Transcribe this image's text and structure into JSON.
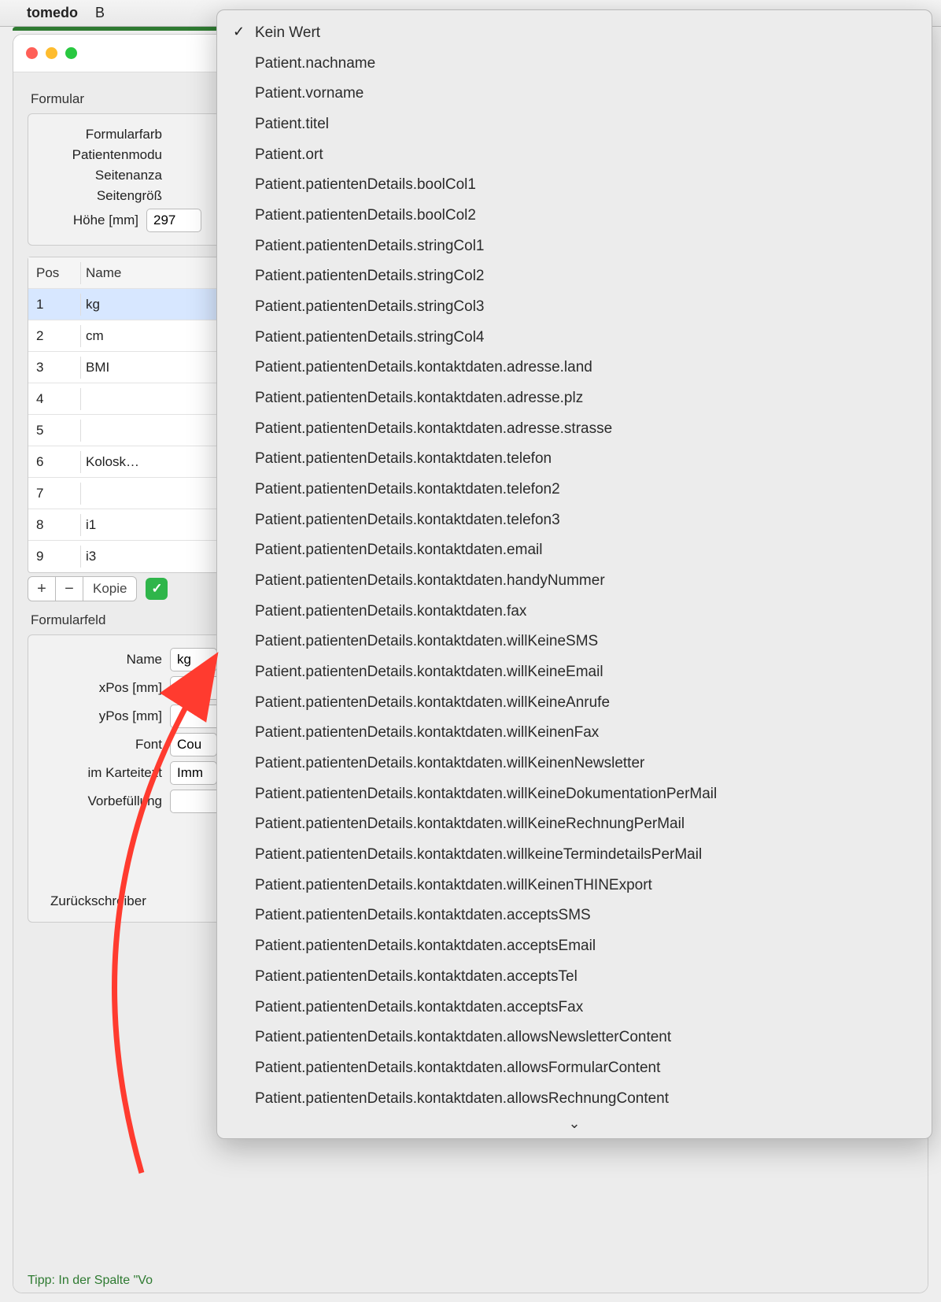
{
  "menubar": {
    "app": "tomedo",
    "partial_item": "B"
  },
  "window": {
    "section_formular": "Formular",
    "labels": {
      "formularfarbe": "Formularfarb",
      "patientenmodus": "Patientenmodu",
      "seitenanzahl": "Seitenanza",
      "seitengroesse": "Seitengröß",
      "hoehe": "Höhe [mm]"
    },
    "hoehe_value": "297",
    "table": {
      "col_pos": "Pos",
      "col_name": "Name",
      "rows": [
        {
          "pos": "1",
          "name": "kg",
          "selected": true
        },
        {
          "pos": "2",
          "name": "cm"
        },
        {
          "pos": "3",
          "name": "BMI"
        },
        {
          "pos": "4",
          "name": ""
        },
        {
          "pos": "5",
          "name": ""
        },
        {
          "pos": "6",
          "name": "Kolosk…"
        },
        {
          "pos": "7",
          "name": ""
        },
        {
          "pos": "8",
          "name": "i1"
        },
        {
          "pos": "9",
          "name": "i3"
        }
      ]
    },
    "buttons": {
      "plus": "+",
      "minus": "−",
      "kopie": "Kopie",
      "check": "✓"
    },
    "section_formularfeld": "Formularfeld",
    "feld": {
      "name_label": "Name",
      "name_value": "kg",
      "xpos_label": "xPos [mm]",
      "ypos_label": "yPos [mm]",
      "font_label": "Font",
      "font_value": "Cou",
      "karteitext_label": "im Karteitext",
      "karteitext_value": "Imm",
      "vorbefuellung_label": "Vorbefüllung",
      "zurueckschreiben": "Zurückschreiber"
    },
    "tip": "Tipp: In der Spalte \"Vo"
  },
  "dropdown": {
    "items": [
      {
        "label": "Kein Wert",
        "checked": true
      },
      {
        "label": "Patient.nachname"
      },
      {
        "label": "Patient.vorname"
      },
      {
        "label": "Patient.titel"
      },
      {
        "label": "Patient.ort"
      },
      {
        "label": "Patient.patientenDetails.boolCol1"
      },
      {
        "label": "Patient.patientenDetails.boolCol2"
      },
      {
        "label": "Patient.patientenDetails.stringCol1"
      },
      {
        "label": "Patient.patientenDetails.stringCol2"
      },
      {
        "label": "Patient.patientenDetails.stringCol3"
      },
      {
        "label": "Patient.patientenDetails.stringCol4"
      },
      {
        "label": "Patient.patientenDetails.kontaktdaten.adresse.land"
      },
      {
        "label": "Patient.patientenDetails.kontaktdaten.adresse.plz"
      },
      {
        "label": "Patient.patientenDetails.kontaktdaten.adresse.strasse"
      },
      {
        "label": "Patient.patientenDetails.kontaktdaten.telefon"
      },
      {
        "label": "Patient.patientenDetails.kontaktdaten.telefon2"
      },
      {
        "label": "Patient.patientenDetails.kontaktdaten.telefon3"
      },
      {
        "label": "Patient.patientenDetails.kontaktdaten.email"
      },
      {
        "label": "Patient.patientenDetails.kontaktdaten.handyNummer"
      },
      {
        "label": "Patient.patientenDetails.kontaktdaten.fax"
      },
      {
        "label": "Patient.patientenDetails.kontaktdaten.willKeineSMS"
      },
      {
        "label": "Patient.patientenDetails.kontaktdaten.willKeineEmail"
      },
      {
        "label": "Patient.patientenDetails.kontaktdaten.willKeineAnrufe"
      },
      {
        "label": "Patient.patientenDetails.kontaktdaten.willKeinenFax"
      },
      {
        "label": "Patient.patientenDetails.kontaktdaten.willKeinenNewsletter"
      },
      {
        "label": "Patient.patientenDetails.kontaktdaten.willKeineDokumentationPerMail"
      },
      {
        "label": "Patient.patientenDetails.kontaktdaten.willKeineRechnungPerMail"
      },
      {
        "label": "Patient.patientenDetails.kontaktdaten.willkeineTermindetailsPerMail"
      },
      {
        "label": "Patient.patientenDetails.kontaktdaten.willKeinenTHINExport"
      },
      {
        "label": "Patient.patientenDetails.kontaktdaten.acceptsSMS"
      },
      {
        "label": "Patient.patientenDetails.kontaktdaten.acceptsEmail"
      },
      {
        "label": "Patient.patientenDetails.kontaktdaten.acceptsTel"
      },
      {
        "label": "Patient.patientenDetails.kontaktdaten.acceptsFax"
      },
      {
        "label": "Patient.patientenDetails.kontaktdaten.allowsNewsletterContent"
      },
      {
        "label": "Patient.patientenDetails.kontaktdaten.allowsFormularContent"
      },
      {
        "label": "Patient.patientenDetails.kontaktdaten.allowsRechnungContent"
      }
    ],
    "more_icon": "⌄"
  }
}
